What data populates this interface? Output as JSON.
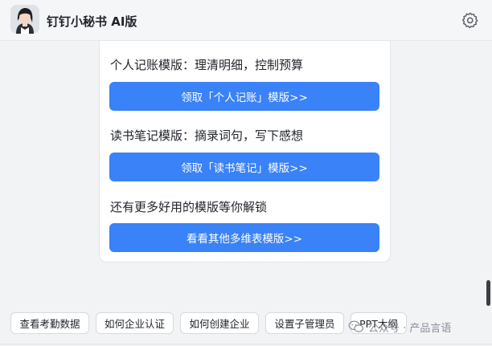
{
  "header": {
    "title": "钉钉小秘书 AI版",
    "avatar_icon": "person-avatar",
    "settings_icon": "gear-icon"
  },
  "card": {
    "item1_text": "个人记账模版：理清明细，控制预算",
    "item1_button": "领取「个人记账」模版>>",
    "item2_text": "读书笔记模版：摘录词句，写下感想",
    "item2_button": "领取「读书笔记」模版>>",
    "item3_text": "还有更多好用的模版等你解锁",
    "item3_button": "看看其他多维表模版>>"
  },
  "quick_actions": [
    {
      "label": "查看考勤数据"
    },
    {
      "label": "如何企业认证"
    },
    {
      "label": "如何创建企业"
    },
    {
      "label": "设置子管理员"
    },
    {
      "label": "PPT大纲"
    }
  ],
  "watermark": {
    "text": "公众号 · 产品言语"
  },
  "colors": {
    "accent": "#3a82f7",
    "background": "#f2f3f5",
    "card": "#ffffff"
  }
}
